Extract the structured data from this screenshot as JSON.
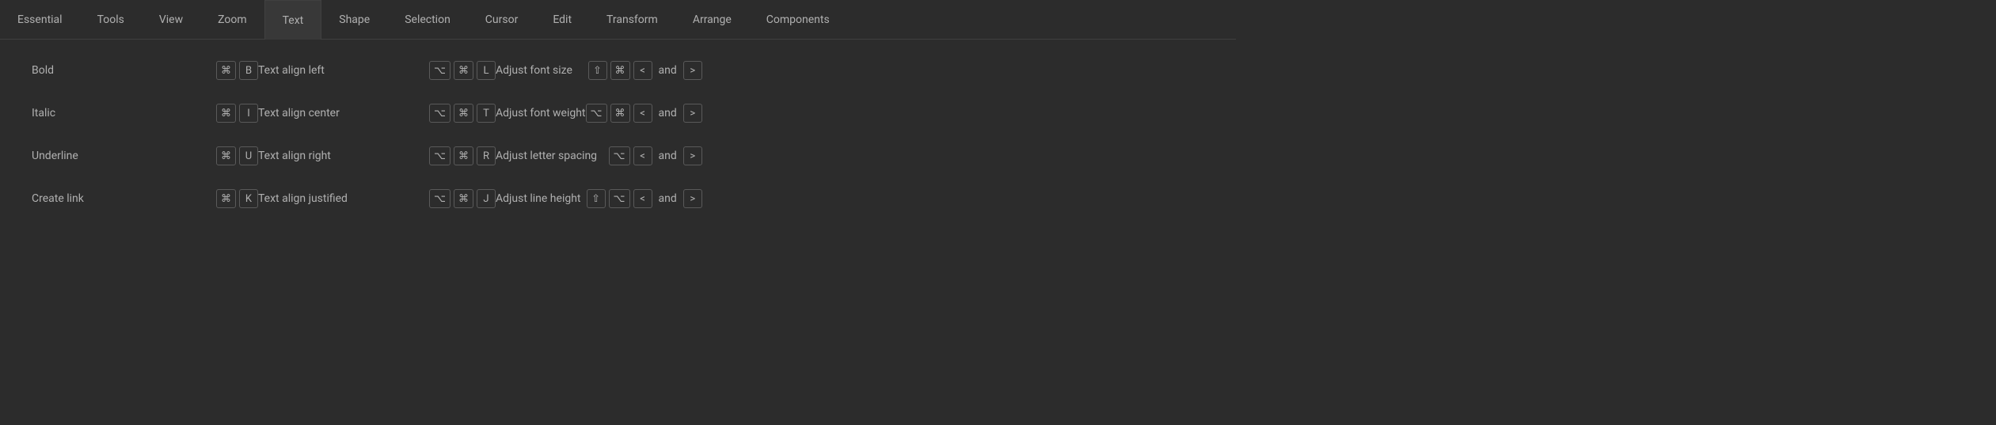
{
  "tabs": [
    {
      "label": "Essential"
    },
    {
      "label": "Tools"
    },
    {
      "label": "View"
    },
    {
      "label": "Zoom"
    },
    {
      "label": "Text",
      "active": true
    },
    {
      "label": "Shape"
    },
    {
      "label": "Selection"
    },
    {
      "label": "Cursor"
    },
    {
      "label": "Edit"
    },
    {
      "label": "Transform"
    },
    {
      "label": "Arrange"
    },
    {
      "label": "Components"
    }
  ],
  "col1": [
    {
      "label": "Bold",
      "keys": [
        "⌘",
        "B"
      ]
    },
    {
      "label": "Italic",
      "keys": [
        "⌘",
        "I"
      ]
    },
    {
      "label": "Underline",
      "keys": [
        "⌘",
        "U"
      ]
    },
    {
      "label": "Create link",
      "keys": [
        "⌘",
        "K"
      ]
    }
  ],
  "col2": [
    {
      "label": "Text align left",
      "keys": [
        "⌥",
        "⌘",
        "L"
      ]
    },
    {
      "label": "Text align center",
      "keys": [
        "⌥",
        "⌘",
        "T"
      ]
    },
    {
      "label": "Text align right",
      "keys": [
        "⌥",
        "⌘",
        "R"
      ]
    },
    {
      "label": "Text align justified",
      "keys": [
        "⌥",
        "⌘",
        "J"
      ]
    }
  ],
  "col3": [
    {
      "label": "Adjust font size",
      "keys1": [
        "⇧",
        "⌘",
        "<"
      ],
      "and": "and",
      "keys2": [
        ">"
      ]
    },
    {
      "label": "Adjust font weight",
      "keys1": [
        "⌥",
        "⌘",
        "<"
      ],
      "and": "and",
      "keys2": [
        ">"
      ]
    },
    {
      "label": "Adjust letter spacing",
      "keys1": [
        "⌥",
        "<"
      ],
      "and": "and",
      "keys2": [
        ">"
      ]
    },
    {
      "label": "Adjust line height",
      "keys1": [
        "⇧",
        "⌥",
        "<"
      ],
      "and": "and",
      "keys2": [
        ">"
      ]
    }
  ]
}
